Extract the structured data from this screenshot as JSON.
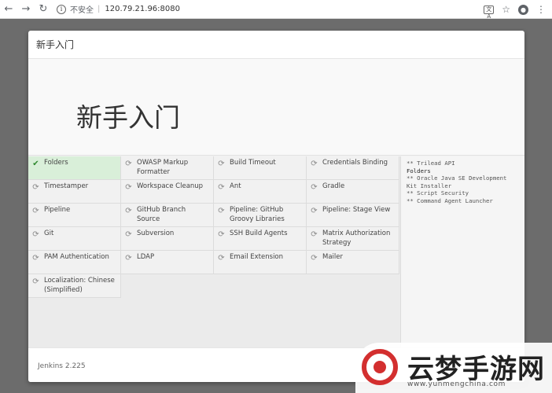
{
  "browser": {
    "security_label": "不安全",
    "url": "120.79.21.96:8080"
  },
  "dialog": {
    "header_title": "新手入门",
    "hero_title": "新手入门",
    "progress_percent": 5,
    "version": "Jenkins 2.225"
  },
  "plugins": [
    {
      "name": "Folders",
      "status": "done"
    },
    {
      "name": "OWASP Markup Formatter",
      "status": "pending"
    },
    {
      "name": "Build Timeout",
      "status": "pending"
    },
    {
      "name": "Credentials Binding",
      "status": "pending"
    },
    {
      "name": "Timestamper",
      "status": "pending"
    },
    {
      "name": "Workspace Cleanup",
      "status": "pending"
    },
    {
      "name": "Ant",
      "status": "pending"
    },
    {
      "name": "Gradle",
      "status": "pending"
    },
    {
      "name": "Pipeline",
      "status": "pending"
    },
    {
      "name": "GitHub Branch Source",
      "status": "pending"
    },
    {
      "name": "Pipeline: GitHub Groovy Libraries",
      "status": "pending"
    },
    {
      "name": "Pipeline: Stage View",
      "status": "pending"
    },
    {
      "name": "Git",
      "status": "pending"
    },
    {
      "name": "Subversion",
      "status": "pending"
    },
    {
      "name": "SSH Build Agents",
      "status": "pending"
    },
    {
      "name": "Matrix Authorization Strategy",
      "status": "pending"
    },
    {
      "name": "PAM Authentication",
      "status": "pending"
    },
    {
      "name": "LDAP",
      "status": "pending"
    },
    {
      "name": "Email Extension",
      "status": "pending"
    },
    {
      "name": "Mailer",
      "status": "pending"
    },
    {
      "name": "Localization: Chinese (Simplified)",
      "status": "pending"
    }
  ],
  "log_lines": [
    {
      "text": "** Trilead API",
      "strong": false
    },
    {
      "text": "Folders",
      "strong": true
    },
    {
      "text": "** Oracle Java SE Development Kit Installer",
      "strong": false
    },
    {
      "text": "** Script Security",
      "strong": false
    },
    {
      "text": "** Command Agent Launcher",
      "strong": false
    }
  ],
  "watermark": {
    "text": "云梦手游网",
    "url": "www.yunmengchina.com"
  },
  "colors": {
    "progress": "#336bb1",
    "done_bg": "#d9efd9",
    "done_icon": "#2f8a2f"
  },
  "icons": {
    "done": "check-icon",
    "pending": "spinner-icon"
  }
}
